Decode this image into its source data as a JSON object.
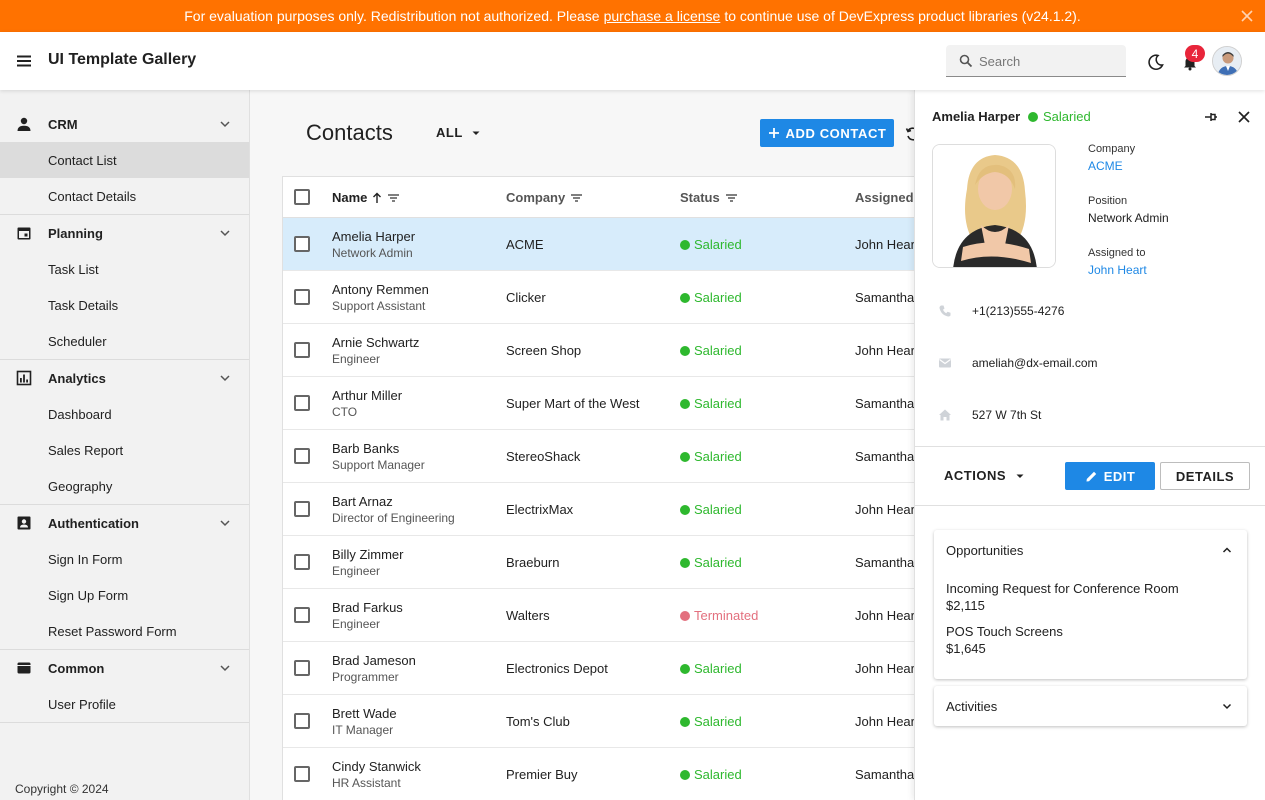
{
  "banner": {
    "text_before": "For evaluation purposes only. Redistribution not authorized. Please",
    "link": "purchase a license",
    "text_after": "to continue use of DevExpress product libraries (v24.1.2)."
  },
  "header": {
    "title": "UI Template Gallery",
    "search_placeholder": "Search",
    "notification_count": "4"
  },
  "sidebar": {
    "groups": [
      {
        "label": "CRM",
        "icon": "person-icon",
        "items": [
          "Contact List",
          "Contact Details"
        ]
      },
      {
        "label": "Planning",
        "icon": "calendar-icon",
        "items": [
          "Task List",
          "Task Details",
          "Scheduler"
        ]
      },
      {
        "label": "Analytics",
        "icon": "chart-icon",
        "items": [
          "Dashboard",
          "Sales Report",
          "Geography"
        ]
      },
      {
        "label": "Authentication",
        "icon": "id-card-icon",
        "items": [
          "Sign In Form",
          "Sign Up Form",
          "Reset Password Form"
        ]
      },
      {
        "label": "Common",
        "icon": "card-icon",
        "items": [
          "User Profile"
        ]
      }
    ],
    "active_item": "Contact List",
    "copyright": "Copyright © 2024"
  },
  "main": {
    "title": "Contacts",
    "filter": "ALL",
    "add_button": "ADD CONTACT",
    "columns": [
      "Name",
      "Company",
      "Status",
      "Assigned t"
    ],
    "rows": [
      {
        "name": "Amelia Harper",
        "position": "Network Admin",
        "company": "ACME",
        "status": "Salaried",
        "assigned": "John Heart",
        "selected": true
      },
      {
        "name": "Antony Remmen",
        "position": "Support Assistant",
        "company": "Clicker",
        "status": "Salaried",
        "assigned": "Samantha"
      },
      {
        "name": "Arnie Schwartz",
        "position": "Engineer",
        "company": "Screen Shop",
        "status": "Salaried",
        "assigned": "John Heart"
      },
      {
        "name": "Arthur Miller",
        "position": "CTO",
        "company": "Super Mart of the West",
        "status": "Salaried",
        "assigned": "Samantha"
      },
      {
        "name": "Barb Banks",
        "position": "Support Manager",
        "company": "StereoShack",
        "status": "Salaried",
        "assigned": "Samantha"
      },
      {
        "name": "Bart Arnaz",
        "position": "Director of Engineering",
        "company": "ElectrixMax",
        "status": "Salaried",
        "assigned": "John Heart"
      },
      {
        "name": "Billy Zimmer",
        "position": "Engineer",
        "company": "Braeburn",
        "status": "Salaried",
        "assigned": "Samantha"
      },
      {
        "name": "Brad Farkus",
        "position": "Engineer",
        "company": "Walters",
        "status": "Terminated",
        "assigned": "John Heart"
      },
      {
        "name": "Brad Jameson",
        "position": "Programmer",
        "company": "Electronics Depot",
        "status": "Salaried",
        "assigned": "John Heart"
      },
      {
        "name": "Brett Wade",
        "position": "IT Manager",
        "company": "Tom's Club",
        "status": "Salaried",
        "assigned": "John Heart"
      },
      {
        "name": "Cindy Stanwick",
        "position": "HR Assistant",
        "company": "Premier Buy",
        "status": "Salaried",
        "assigned": "Samantha"
      }
    ]
  },
  "panel": {
    "name": "Amelia Harper",
    "status": "Salaried",
    "company_label": "Company",
    "company": "ACME",
    "position_label": "Position",
    "position": "Network Admin",
    "assigned_label": "Assigned to",
    "assigned": "John Heart",
    "phone": "+1(213)555-4276",
    "email": "ameliah@dx-email.com",
    "address": "527 W 7th St",
    "actions_label": "ACTIONS",
    "edit_label": "EDIT",
    "details_label": "DETAILS",
    "opportunities_title": "Opportunities",
    "opportunities": [
      {
        "title": "Incoming Request for Conference Room",
        "amount": "$2,115"
      },
      {
        "title": "POS Touch Screens",
        "amount": "$1,645"
      }
    ],
    "activities_title": "Activities"
  },
  "colors": {
    "banner": "#ff7200",
    "accent": "#1e88e5",
    "salaried": "#2eb82e",
    "terminated": "#e3707e",
    "selected_row": "#d7ecfb",
    "badge": "#e8253a"
  }
}
